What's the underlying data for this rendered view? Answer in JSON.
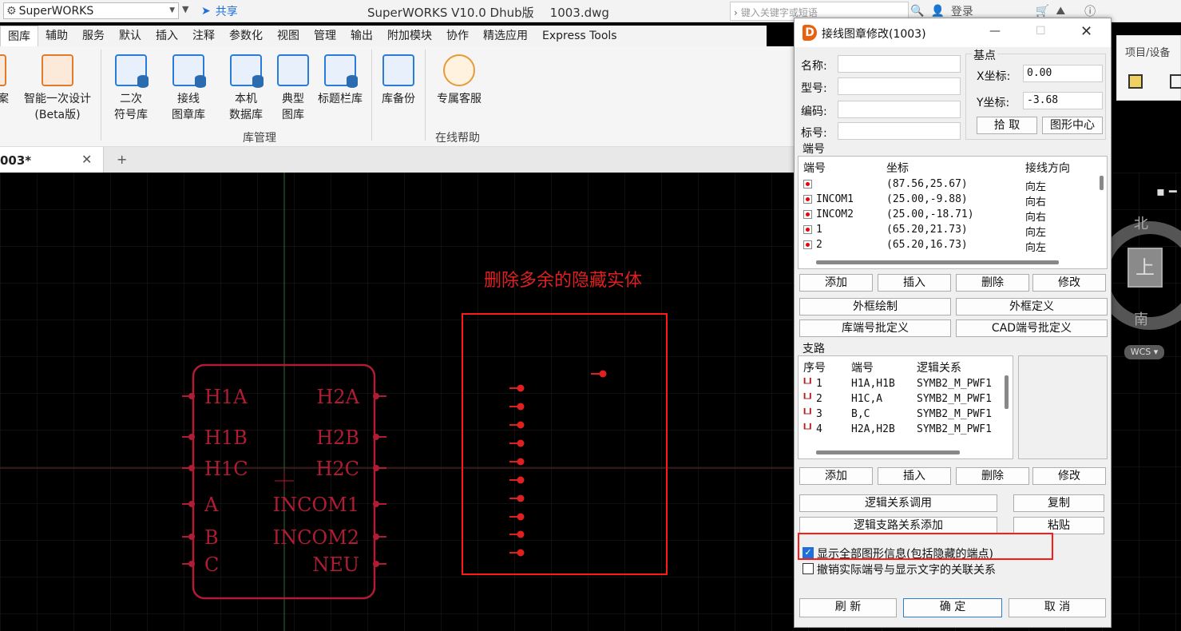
{
  "titlebar": {
    "app_name": "SuperWORKS",
    "share": "共享",
    "window_title": "SuperWORKS V10.0 Dhub版",
    "file_name": "1003.dwg",
    "search_placeholder": "键入关键字或短语",
    "login": "登录"
  },
  "menu": [
    "图库",
    "辅助",
    "服务",
    "默认",
    "插入",
    "注释",
    "参数化",
    "视图",
    "管理",
    "输出",
    "附加模块",
    "协作",
    "精选应用",
    "Express Tools"
  ],
  "ribbon": {
    "buttons": [
      {
        "line1": "案",
        "line2": ""
      },
      {
        "line1": "智能一次设计",
        "line2": "(Beta版)"
      },
      {
        "line1": "二次",
        "line2": "符号库"
      },
      {
        "line1": "接线",
        "line2": "图章库"
      },
      {
        "line1": "本机",
        "line2": "数据库"
      },
      {
        "line1": "典型",
        "line2": "图库"
      },
      {
        "line1": "标题栏库",
        "line2": ""
      },
      {
        "line1": "库备份",
        "line2": ""
      },
      {
        "line1": "专属客服",
        "line2": ""
      }
    ],
    "groups": {
      "lib_manage": "库管理",
      "online_help": "在线帮助"
    }
  },
  "tabs": {
    "doc": "003*"
  },
  "right_panel": {
    "title": "项目/设备"
  },
  "viewcube": {
    "north": "北",
    "top": "上",
    "south": "南",
    "wcs": "WCS"
  },
  "canvas": {
    "annotation": "删除多余的隐藏实体",
    "symbol_left_labels": [
      "H1A",
      "H1B",
      "H1C",
      "A",
      "B",
      "C"
    ],
    "symbol_right_labels": [
      "H2A",
      "H2B",
      "H2C",
      "INCOM1",
      "INCOM2",
      "NEU"
    ]
  },
  "dialog": {
    "title": "接线图章修改(1003)",
    "fields": {
      "name": "名称:",
      "model": "型号:",
      "code": "编码:",
      "tag": "标号:"
    },
    "base_point": {
      "label": "基点",
      "x_label": "X坐标:",
      "x_value": "0.00",
      "y_label": "Y坐标:",
      "y_value": "-3.68",
      "pick": "拾  取",
      "center": "图形中心"
    },
    "terminals": {
      "section": "端号",
      "headers": [
        "端号",
        "坐标",
        "接线方向"
      ],
      "rows": [
        {
          "name": "",
          "coord": "(87.56,25.67)",
          "dir": "向左"
        },
        {
          "name": "INCOM1",
          "coord": "(25.00,-9.88)",
          "dir": "向右"
        },
        {
          "name": "INCOM2",
          "coord": "(25.00,-18.71)",
          "dir": "向右"
        },
        {
          "name": "1",
          "coord": "(65.20,21.73)",
          "dir": "向左"
        },
        {
          "name": "2",
          "coord": "(65.20,16.73)",
          "dir": "向左"
        }
      ]
    },
    "term_buttons": {
      "add": "添加",
      "insert": "插入",
      "delete": "删除",
      "modify": "修改"
    },
    "frame_draw": "外框绘制",
    "frame_define": "外框定义",
    "lib_batch": "库端号批定义",
    "cad_batch": "CAD端号批定义",
    "branches": {
      "section": "支路",
      "headers": [
        "序号",
        "端号",
        "逻辑关系"
      ],
      "rows": [
        {
          "no": "1",
          "term": "H1A,H1B",
          "logic": "SYMB2_M_PWF1"
        },
        {
          "no": "2",
          "term": "H1C,A",
          "logic": "SYMB2_M_PWF1"
        },
        {
          "no": "3",
          "term": "B,C",
          "logic": "SYMB2_M_PWF1"
        },
        {
          "no": "4",
          "term": "H2A,H2B",
          "logic": "SYMB2_M_PWF1"
        }
      ]
    },
    "branch_buttons": {
      "add": "添加",
      "insert": "插入",
      "delete": "删除",
      "modify": "修改"
    },
    "logic_call": "逻辑关系调用",
    "copy": "复制",
    "logic_branch_add": "逻辑支路关系添加",
    "paste": "粘贴",
    "check_show_all": "显示全部图形信息(包括隐藏的端点)",
    "check_unlink": "撤销实际端号与显示文字的关联关系",
    "refresh": "刷  新",
    "ok": "确  定",
    "cancel": "取  消"
  },
  "colors": {
    "symbol": "#b01c33",
    "annotation": "#e02020",
    "highlight_box": "#ff1a1a"
  }
}
